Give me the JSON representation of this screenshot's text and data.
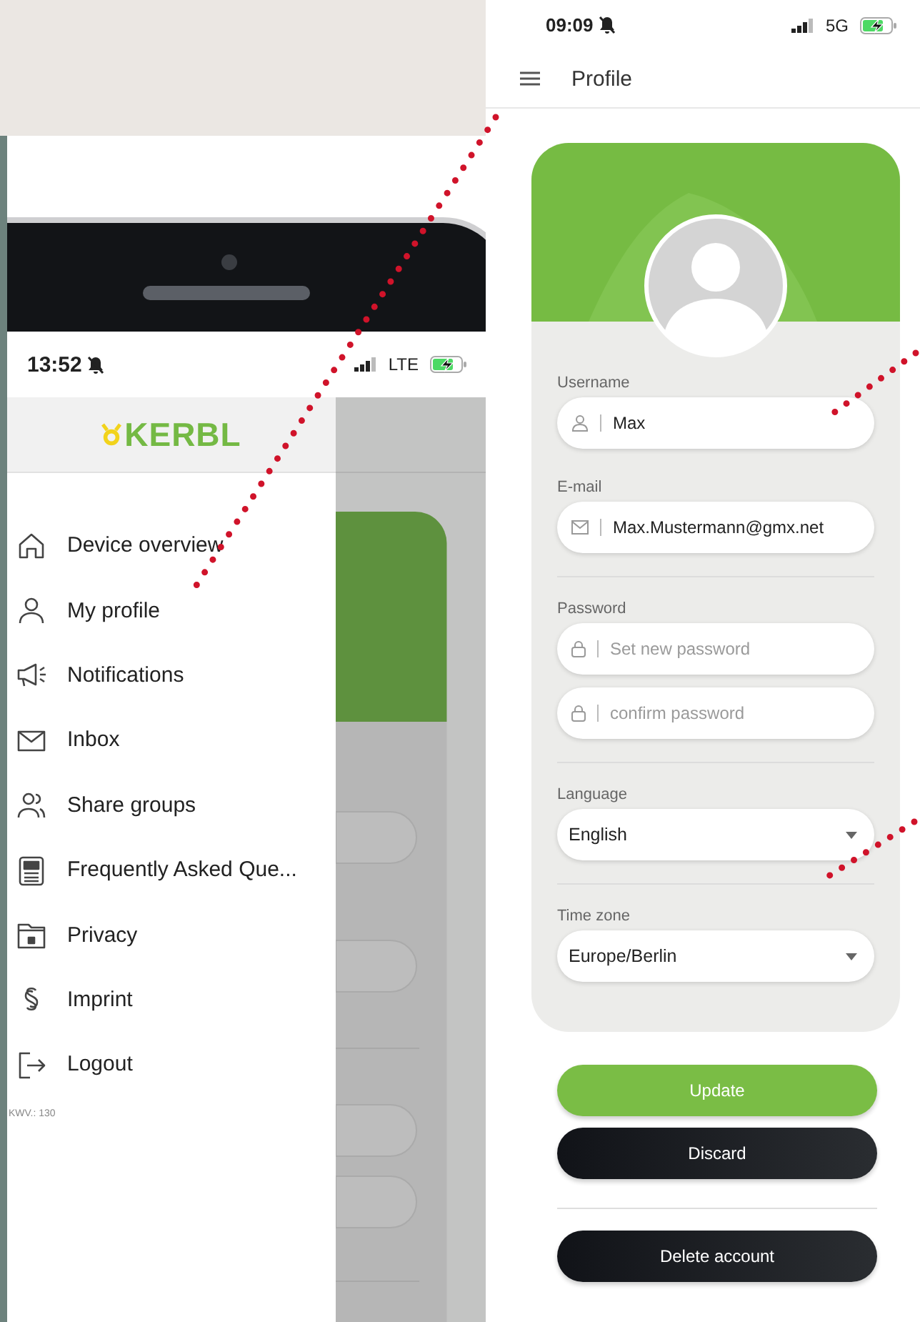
{
  "phone": {
    "status_bar": {
      "time": "13:52",
      "network": "LTE"
    },
    "drawer": {
      "logo": "KERBL",
      "items": [
        {
          "label": "Device overview"
        },
        {
          "label": "My profile"
        },
        {
          "label": "Notifications"
        },
        {
          "label": "Inbox"
        },
        {
          "label": "Share groups"
        },
        {
          "label": "Frequently Asked Que..."
        },
        {
          "label": "Privacy"
        },
        {
          "label": "Imprint"
        },
        {
          "label": "Logout"
        }
      ],
      "version": "KWV.: 130"
    }
  },
  "screen": {
    "status_bar": {
      "time": "09:09",
      "network": "5G"
    },
    "title": "Profile",
    "sections": [
      {
        "label": "Username",
        "fields": [
          {
            "kind": "user",
            "value": "Max"
          }
        ]
      },
      {
        "label": "E-mail",
        "fields": [
          {
            "kind": "mail",
            "value": "Max.Mustermann@gmx.net"
          }
        ]
      },
      {
        "label": "Password",
        "fields": [
          {
            "kind": "lock",
            "placeholder": "Set new password"
          },
          {
            "kind": "lock",
            "placeholder": "confirm password"
          }
        ]
      },
      {
        "label": "Language",
        "fields": [
          {
            "kind": "select",
            "value": "English"
          }
        ]
      },
      {
        "label": "Time zone",
        "fields": [
          {
            "kind": "select",
            "value": "Europe/Berlin"
          }
        ]
      }
    ],
    "buttons": [
      {
        "label": "Update",
        "kind": "primary"
      },
      {
        "label": "Discard",
        "kind": "dark"
      },
      {
        "label": "Delete account",
        "kind": "dark"
      }
    ]
  }
}
